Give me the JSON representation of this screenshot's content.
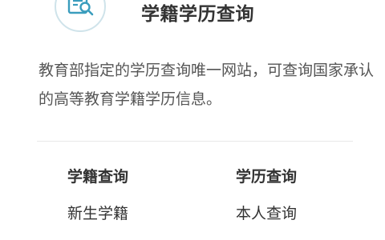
{
  "header": {
    "title": "学籍学历查询",
    "icon": "document-search-icon",
    "icon_color": "#3a9dbd"
  },
  "description": "教育部指定的学历查询唯一网站，可查询国家承认的高等教育学籍学历信息。",
  "columns": {
    "left": {
      "heading": "学籍查询",
      "links": [
        "新生学籍"
      ]
    },
    "right": {
      "heading": "学历查询",
      "links": [
        "本人查询"
      ]
    }
  }
}
